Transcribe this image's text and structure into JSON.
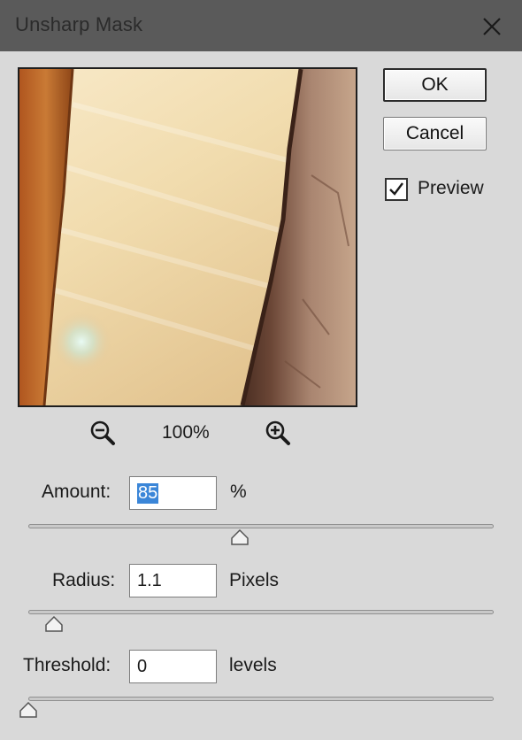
{
  "window": {
    "title": "Unsharp Mask"
  },
  "buttons": {
    "ok": "OK",
    "cancel": "Cancel"
  },
  "preview_checkbox": {
    "label": "Preview",
    "checked": true
  },
  "zoom": {
    "level": "100%"
  },
  "amount": {
    "label": "Amount:",
    "value": "85",
    "unit": "%",
    "slider_fraction": 0.455
  },
  "radius": {
    "label": "Radius:",
    "value": "1.1",
    "unit": "Pixels",
    "slider_fraction": 0.055
  },
  "threshold": {
    "label": "Threshold:",
    "value": "0",
    "unit": "levels",
    "slider_fraction": 0.0
  }
}
